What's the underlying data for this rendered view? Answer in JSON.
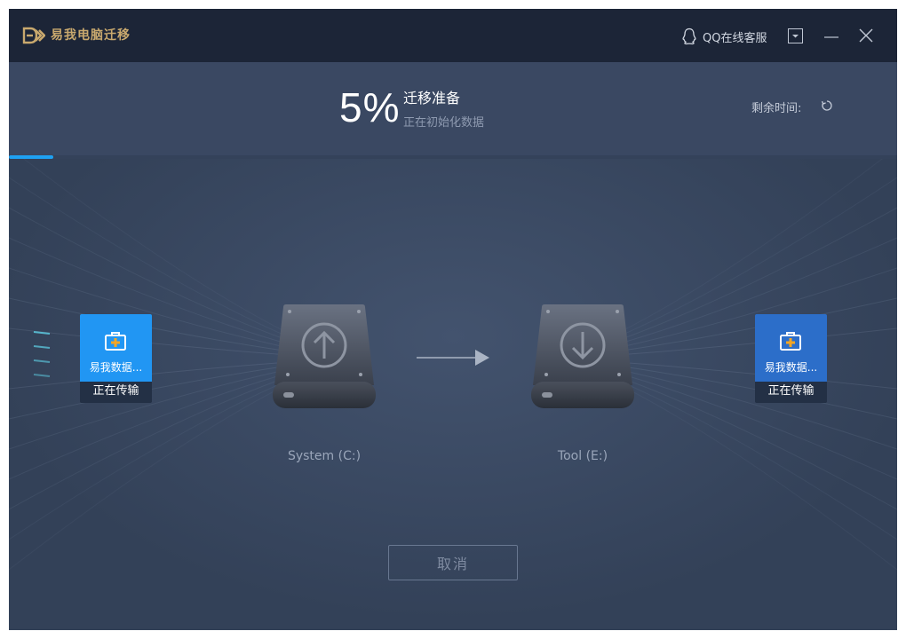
{
  "titlebar": {
    "app_title": "易我电脑迁移",
    "qq_label": "QQ在线客服"
  },
  "progress": {
    "percent_text": "5%",
    "percent": 5,
    "stage_title": "迁移准备",
    "stage_subtitle": "正在初始化数据",
    "remaining_label": "剩余时间:"
  },
  "transfer": {
    "left_card": {
      "name": "易我数据...",
      "status": "正在传输",
      "icon": "toolbox-icon"
    },
    "right_card": {
      "name": "易我数据...",
      "status": "正在传输",
      "icon": "toolbox-icon"
    },
    "source_drive": {
      "label": "System (C:)",
      "icon": "upload-arrow-icon"
    },
    "target_drive": {
      "label": "Tool (E:)",
      "icon": "download-arrow-icon"
    }
  },
  "actions": {
    "cancel_label": "取消"
  },
  "colors": {
    "accent": "#1ea1f2",
    "titlebar_bg": "#1c2537",
    "window_bg": "#3b4a63",
    "brand_gold": "#c9a96e"
  }
}
